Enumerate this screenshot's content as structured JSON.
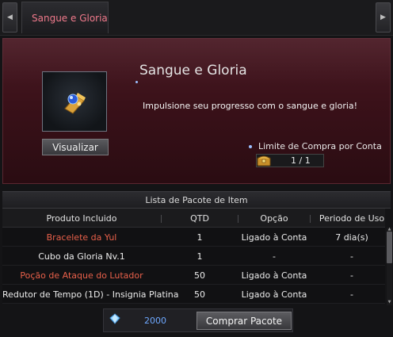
{
  "tabs": [
    {
      "label": "Sangue e Gloria"
    }
  ],
  "hero": {
    "title": "Sangue e Gloria",
    "description": "Impulsione seu progresso com o sangue e gloria!",
    "preview_button": "Visualizar",
    "limit_label": "Limite de Compra por Conta",
    "limit_value": "1 / 1",
    "item_icon": "golden-cube-icon"
  },
  "list": {
    "title": "Lista de Pacote de Item",
    "columns": [
      "Produto Incluido",
      "QTD",
      "Opção",
      "Periodo de Uso"
    ],
    "rows": [
      {
        "name": "Bracelete da Yul",
        "qty": "1",
        "option": "Ligado à Conta",
        "period": "7 dia(s)",
        "highlight": true
      },
      {
        "name": "Cubo da Gloria Nv.1",
        "qty": "1",
        "option": "-",
        "period": "-",
        "highlight": false
      },
      {
        "name": "Poção de Ataque do Lutador",
        "qty": "50",
        "option": "Ligado à Conta",
        "period": "-",
        "highlight": true
      },
      {
        "name": "Redutor de Tempo (1D) - Insignia Platina",
        "qty": "50",
        "option": "Ligado à Conta",
        "period": "-",
        "highlight": false
      }
    ]
  },
  "footer": {
    "price": "2000",
    "currency_icon": "diamond-icon",
    "buy_button": "Comprar Pacote"
  },
  "colors": {
    "accent_red": "#e8604a",
    "tab_pink": "#f07a8c",
    "price_blue": "#6ea8ff"
  }
}
